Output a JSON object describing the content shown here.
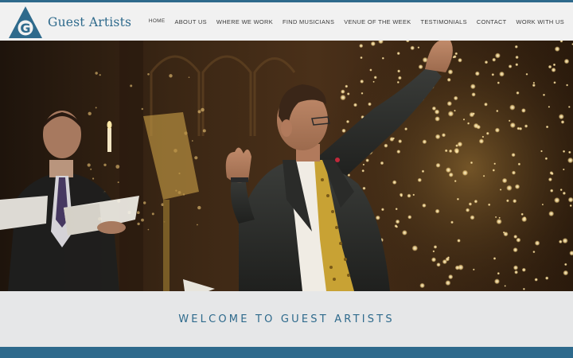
{
  "brand": {
    "name": "Guest Artists",
    "logo_letter": "G",
    "accent": "#2e6a8c"
  },
  "nav": {
    "items": [
      {
        "label": "HOME"
      },
      {
        "label": "ABOUT US"
      },
      {
        "label": "WHERE WE WORK"
      },
      {
        "label": "FIND MUSICIANS"
      },
      {
        "label": "VENUE OF THE WEEK"
      },
      {
        "label": "TESTIMONIALS"
      },
      {
        "label": "CONTACT"
      },
      {
        "label": "WORK WITH US"
      }
    ]
  },
  "hero": {
    "image": "conductor-with-choir-singer-and-lit-christmas-tree"
  },
  "welcome": {
    "title": "Welcome to Guest Artists"
  }
}
